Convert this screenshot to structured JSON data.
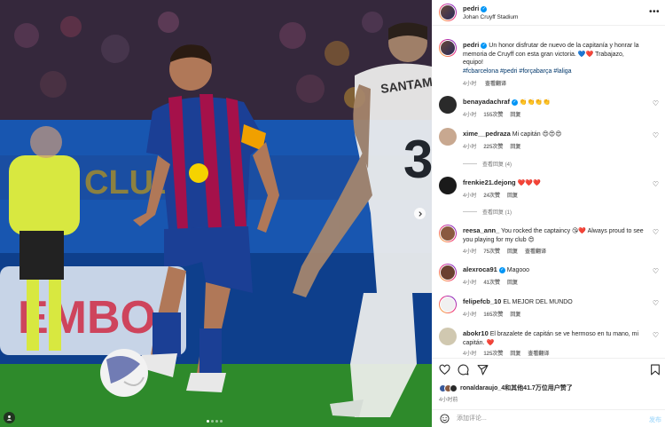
{
  "post": {
    "author": "pedri",
    "location": "Johan Cruyff Stadium",
    "caption": "Un honor disfrutar de nuevo de la capitanía y honrar la memoria de Cruyff con esta gran victoria. 💙❤️ Trabajazo, equipo!",
    "hashtags": "#fcbarcelona #pedri #forçabarça #laliga",
    "caption_time": "4小时",
    "caption_translate": "查看翻译"
  },
  "comments": [
    {
      "user": "benayadachraf",
      "verified": true,
      "text": "👏👏👏👏",
      "time": "4小时",
      "likes": "155次赞",
      "reply": "回复"
    },
    {
      "user": "xime__pedraza",
      "verified": false,
      "text": "Mi capitán 😍😍😍",
      "time": "4小时",
      "likes": "225次赞",
      "reply": "回复",
      "view_replies": "查看回复 (4)"
    },
    {
      "user": "frenkie21.dejong",
      "verified": false,
      "text": "❤️❤️❤️",
      "time": "4小时",
      "likes": "24次赞",
      "reply": "回复",
      "view_replies": "查看回复 (1)"
    },
    {
      "user": "reesa_ann_",
      "verified": false,
      "text": "You rocked the captaincy 😘❤️ Always proud to see you playing for my club 😍",
      "time": "4小时",
      "likes": "75次赞",
      "reply": "回复",
      "translate": "查看翻译"
    },
    {
      "user": "alexroca91",
      "verified": true,
      "text": "Magooo",
      "time": "4小时",
      "likes": "41次赞",
      "reply": "回复"
    },
    {
      "user": "felipefcb_10",
      "verified": false,
      "text": "EL MEJOR DEL MUNDO",
      "time": "4小时",
      "likes": "165次赞",
      "reply": "回复"
    },
    {
      "user": "abokr10",
      "verified": false,
      "text": "El brazalete de capitán se ve hermoso en tu mano, mi capitán. ❤️",
      "time": "4小时",
      "likes": "125次赞",
      "reply": "回复",
      "translate": "查看翻译"
    }
  ],
  "likes_summary": "ronaldaraujo_4和其他41.7万位用户赞了",
  "time_ago": "4小时前",
  "comment_box": {
    "placeholder": "添加评论...",
    "post_label": "发布"
  },
  "media": {
    "jersey_number": "3"
  },
  "colors": {
    "accent_blue": "#0095f6",
    "heart_red": "#ed4956",
    "link_blue": "#00376b",
    "muted": "#737373"
  },
  "icons": [
    "heart-icon",
    "comment-icon",
    "share-icon",
    "bookmark-icon",
    "emoji-icon",
    "more-icon",
    "verified-icon",
    "next-arrow-icon",
    "user-tag-icon"
  ]
}
